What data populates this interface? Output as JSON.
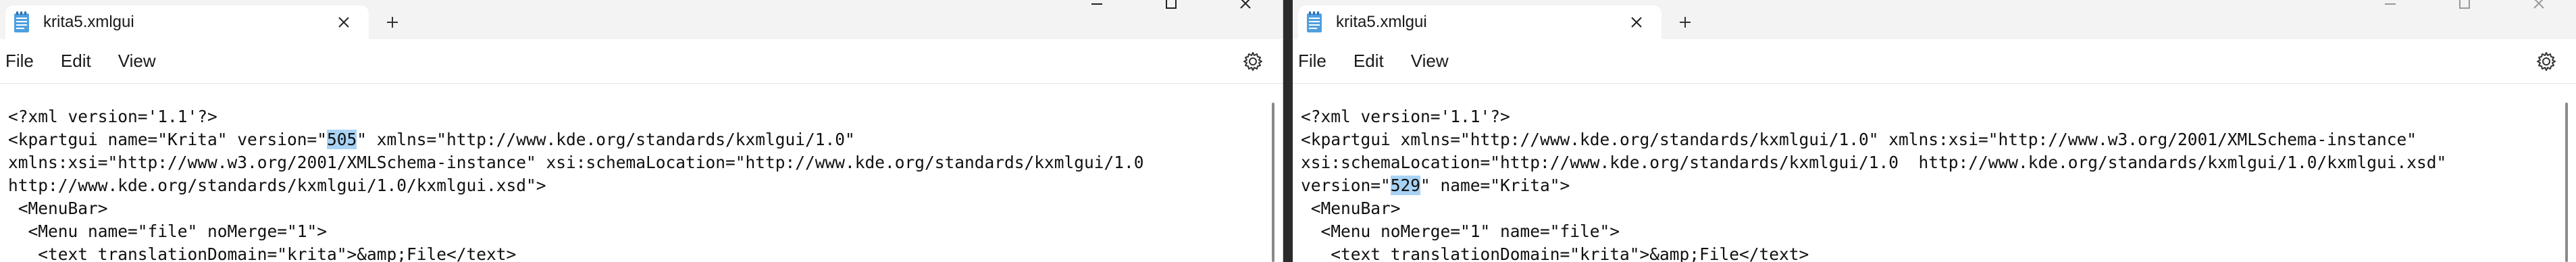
{
  "windows": [
    {
      "tab_title": "krita5.xmlgui",
      "menu": {
        "file": "File",
        "edit": "Edit",
        "view": "View"
      },
      "icons": {
        "document": "notepad-icon",
        "close": "close-icon",
        "new_tab": "plus-icon",
        "settings": "gear-icon"
      },
      "lines": [
        {
          "a": "<?xml version='1.1'?>",
          "h": "",
          "b": ""
        },
        {
          "a": "<kpartgui name=\"Krita\" version=\"",
          "h": "505",
          "b": "\" xmlns=\"http://www.kde.org/standards/kxmlgui/1.0\""
        },
        {
          "a": "xmlns:xsi=\"http://www.w3.org/2001/XMLSchema-instance\" xsi:schemaLocation=\"http://www.kde.org/standards/kxmlgui/1.0",
          "h": "",
          "b": ""
        },
        {
          "a": "http://www.kde.org/standards/kxmlgui/1.0/kxmlgui.xsd\">",
          "h": "",
          "b": ""
        },
        {
          "a": " <MenuBar>",
          "h": "",
          "b": ""
        },
        {
          "a": "  <Menu name=\"file\" noMerge=\"1\">",
          "h": "",
          "b": ""
        },
        {
          "a": "   <text translationDomain=\"krita\">&amp;File</text>",
          "h": "",
          "b": ""
        }
      ]
    },
    {
      "tab_title": "krita5.xmlgui",
      "menu": {
        "file": "File",
        "edit": "Edit",
        "view": "View"
      },
      "icons": {
        "document": "notepad-icon",
        "close": "close-icon",
        "new_tab": "plus-icon",
        "settings": "gear-icon"
      },
      "lines": [
        {
          "a": "<?xml version='1.1'?>",
          "h": "",
          "b": ""
        },
        {
          "a": "<kpartgui xmlns=\"http://www.kde.org/standards/kxmlgui/1.0\" xmlns:xsi=\"http://www.w3.org/2001/XMLSchema-instance\"",
          "h": "",
          "b": ""
        },
        {
          "a": "xsi:schemaLocation=\"http://www.kde.org/standards/kxmlgui/1.0  http://www.kde.org/standards/kxmlgui/1.0/kxmlgui.xsd\"",
          "h": "",
          "b": ""
        },
        {
          "a": "version=\"",
          "h": "529",
          "b": "\" name=\"Krita\">"
        },
        {
          "a": " <MenuBar>",
          "h": "",
          "b": ""
        },
        {
          "a": "  <Menu noMerge=\"1\" name=\"file\">",
          "h": "",
          "b": ""
        },
        {
          "a": "   <text translationDomain=\"krita\">&amp;File</text>",
          "h": "",
          "b": ""
        }
      ]
    }
  ],
  "colors": {
    "highlight": "#a8d3f5",
    "titlebar": "#f3f3f3"
  }
}
